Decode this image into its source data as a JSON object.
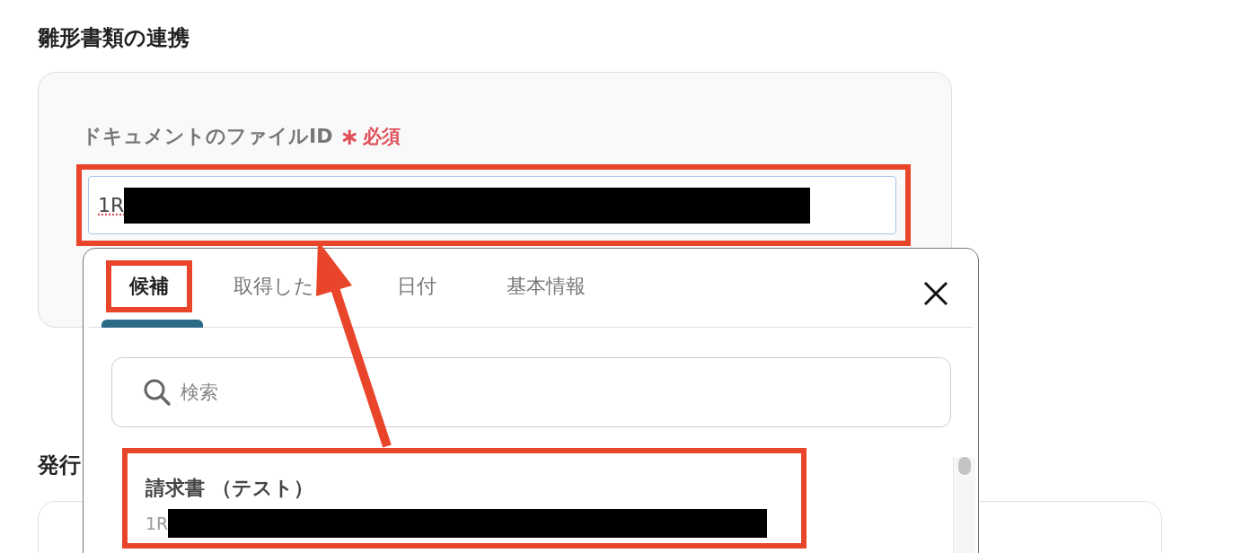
{
  "section_title": "雛形書類の連携",
  "field": {
    "label": "ドキュメントのファイルID",
    "required_mark": "∗",
    "required_label": "必須",
    "value": "1R",
    "annotated": true
  },
  "picker": {
    "tabs": [
      {
        "label": "候補",
        "selected": true,
        "annotated": true
      },
      {
        "label": "取得した",
        "selected": false,
        "annotated": false
      },
      {
        "label": "日付",
        "selected": false,
        "annotated": false
      },
      {
        "label": "基本情報",
        "selected": false,
        "annotated": false
      }
    ],
    "search": {
      "placeholder": "検索"
    },
    "items": [
      {
        "title": "請求書 （テスト）",
        "value": "1R",
        "annotated": true
      }
    ]
  },
  "next_section_title": "発行"
}
